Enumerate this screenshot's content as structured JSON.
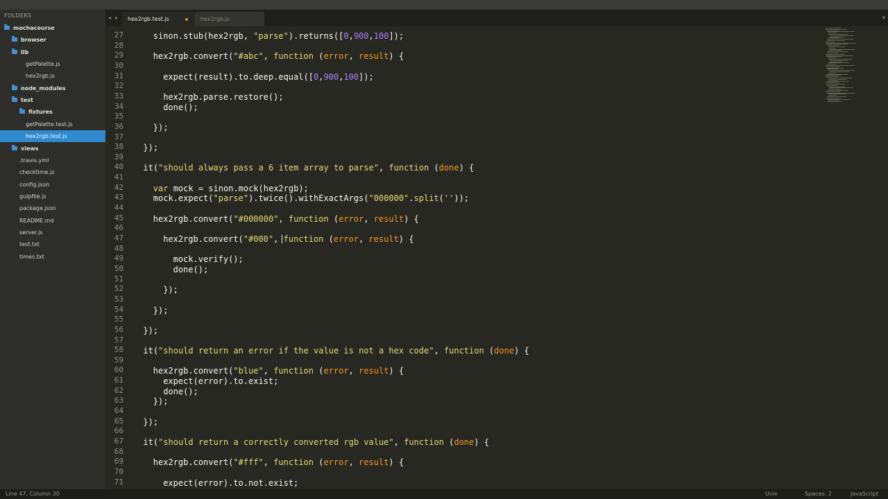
{
  "sidebar": {
    "heading": "FOLDERS",
    "items": [
      {
        "label": "mochacourse",
        "type": "folder",
        "depth": 0
      },
      {
        "label": "browser",
        "type": "folder",
        "depth": 1
      },
      {
        "label": "lib",
        "type": "folder",
        "depth": 1
      },
      {
        "label": "getPalette.js",
        "type": "file",
        "depth": 2
      },
      {
        "label": "hex2rgb.js",
        "type": "file",
        "depth": 2
      },
      {
        "label": "node_modules",
        "type": "folder",
        "depth": 1
      },
      {
        "label": "test",
        "type": "folder",
        "depth": 1
      },
      {
        "label": "fixtures",
        "type": "folder",
        "depth": 2
      },
      {
        "label": "getPalette.test.js",
        "type": "file",
        "depth": 2
      },
      {
        "label": "hex2rgb.test.js",
        "type": "file",
        "depth": 2,
        "selected": true
      },
      {
        "label": "views",
        "type": "folder",
        "depth": 1
      },
      {
        "label": ".travis.yml",
        "type": "file",
        "depth": 1
      },
      {
        "label": "checktime.js",
        "type": "file",
        "depth": 1
      },
      {
        "label": "config.json",
        "type": "file",
        "depth": 1
      },
      {
        "label": "gulpfile.js",
        "type": "file",
        "depth": 1
      },
      {
        "label": "package.json",
        "type": "file",
        "depth": 1
      },
      {
        "label": "README.md",
        "type": "file",
        "depth": 1
      },
      {
        "label": "server.js",
        "type": "file",
        "depth": 1
      },
      {
        "label": "test.txt",
        "type": "file",
        "depth": 1
      },
      {
        "label": "times.txt",
        "type": "file",
        "depth": 1
      }
    ]
  },
  "tabs": {
    "back_icon": "◂",
    "forward_icon": "▸",
    "active": "hex2rgb.test.js",
    "inactive": "hex2rgb.js",
    "scroll_icon": "▾"
  },
  "editor": {
    "lines": [
      {
        "n": "27",
        "indent": 2,
        "tokens": [
          [
            "k",
            "sinon.stub(hex2rgb, "
          ],
          [
            "s",
            "\"parse\""
          ],
          [
            "k",
            ").returns(["
          ],
          [
            "n",
            "0"
          ],
          [
            "k",
            ","
          ],
          [
            "n",
            "900"
          ],
          [
            "k",
            ","
          ],
          [
            "n",
            "100"
          ],
          [
            "k",
            "]);"
          ]
        ]
      },
      {
        "n": "28",
        "indent": 0,
        "tokens": []
      },
      {
        "n": "29",
        "indent": 2,
        "tokens": [
          [
            "k",
            "hex2rgb.convert("
          ],
          [
            "s",
            "\"#abc\""
          ],
          [
            "k",
            ", "
          ],
          [
            "kw",
            "function"
          ],
          [
            "k",
            " ("
          ],
          [
            "p",
            "error"
          ],
          [
            "k",
            ", "
          ],
          [
            "p",
            "result"
          ],
          [
            "k",
            ") {"
          ]
        ]
      },
      {
        "n": "30",
        "indent": 0,
        "tokens": []
      },
      {
        "n": "31",
        "indent": 3,
        "tokens": [
          [
            "k",
            "expect(result).to.deep.equal(["
          ],
          [
            "n",
            "0"
          ],
          [
            "k",
            ","
          ],
          [
            "n",
            "900"
          ],
          [
            "k",
            ","
          ],
          [
            "n",
            "100"
          ],
          [
            "k",
            "]);"
          ]
        ]
      },
      {
        "n": "32",
        "indent": 0,
        "tokens": []
      },
      {
        "n": "33",
        "indent": 3,
        "tokens": [
          [
            "k",
            "hex2rgb.parse.restore();"
          ]
        ]
      },
      {
        "n": "34",
        "indent": 3,
        "tokens": [
          [
            "k",
            "done();"
          ]
        ]
      },
      {
        "n": "35",
        "indent": 0,
        "tokens": []
      },
      {
        "n": "36",
        "indent": 2,
        "tokens": [
          [
            "k",
            "});"
          ]
        ]
      },
      {
        "n": "37",
        "indent": 0,
        "tokens": []
      },
      {
        "n": "38",
        "indent": 1,
        "tokens": [
          [
            "k",
            "});"
          ]
        ]
      },
      {
        "n": "39",
        "indent": 0,
        "tokens": []
      },
      {
        "n": "40",
        "indent": 1,
        "tokens": [
          [
            "k",
            "it("
          ],
          [
            "s",
            "\"should always pass a 6 item array to parse\""
          ],
          [
            "k",
            ", "
          ],
          [
            "kw",
            "function"
          ],
          [
            "k",
            " ("
          ],
          [
            "p",
            "done"
          ],
          [
            "k",
            ") {"
          ]
        ]
      },
      {
        "n": "41",
        "indent": 0,
        "tokens": []
      },
      {
        "n": "42",
        "indent": 2,
        "tokens": [
          [
            "kw",
            "var"
          ],
          [
            "k",
            " mock = sinon.mock(hex2rgb);"
          ]
        ]
      },
      {
        "n": "43",
        "indent": 2,
        "tokens": [
          [
            "k",
            "mock.expect("
          ],
          [
            "s",
            "\"parse\""
          ],
          [
            "k",
            ").twice().withExactArgs("
          ],
          [
            "s",
            "\"000000\""
          ],
          [
            "k",
            "."
          ],
          [
            "y",
            "split"
          ],
          [
            "k",
            "("
          ],
          [
            "s",
            "''"
          ],
          [
            "k",
            "));"
          ]
        ]
      },
      {
        "n": "44",
        "indent": 0,
        "tokens": []
      },
      {
        "n": "45",
        "indent": 2,
        "tokens": [
          [
            "k",
            "hex2rgb.convert("
          ],
          [
            "s",
            "\"#000000\""
          ],
          [
            "k",
            ", "
          ],
          [
            "kw",
            "function"
          ],
          [
            "k",
            " ("
          ],
          [
            "p",
            "error"
          ],
          [
            "k",
            ", "
          ],
          [
            "p",
            "result"
          ],
          [
            "k",
            ") {"
          ]
        ]
      },
      {
        "n": "46",
        "indent": 0,
        "tokens": []
      },
      {
        "n": "47",
        "indent": 3,
        "tokens": [
          [
            "k",
            "hex2rgb.convert("
          ],
          [
            "s",
            "\"#000\""
          ],
          [
            "k",
            ", "
          ],
          [
            "kw",
            "function"
          ],
          [
            "k",
            " ("
          ],
          [
            "p",
            "error"
          ],
          [
            "k",
            ", "
          ],
          [
            "p",
            "result"
          ],
          [
            "k",
            ") {"
          ]
        ]
      },
      {
        "n": "48",
        "indent": 0,
        "tokens": []
      },
      {
        "n": "49",
        "indent": 4,
        "tokens": [
          [
            "k",
            "mock.verify();"
          ]
        ]
      },
      {
        "n": "50",
        "indent": 4,
        "tokens": [
          [
            "k",
            "done();"
          ]
        ]
      },
      {
        "n": "51",
        "indent": 0,
        "tokens": []
      },
      {
        "n": "52",
        "indent": 3,
        "tokens": [
          [
            "k",
            "});"
          ]
        ]
      },
      {
        "n": "53",
        "indent": 0,
        "tokens": []
      },
      {
        "n": "54",
        "indent": 2,
        "tokens": [
          [
            "k",
            "});"
          ]
        ]
      },
      {
        "n": "55",
        "indent": 0,
        "tokens": []
      },
      {
        "n": "56",
        "indent": 1,
        "tokens": [
          [
            "k",
            "});"
          ]
        ]
      },
      {
        "n": "57",
        "indent": 0,
        "tokens": []
      },
      {
        "n": "58",
        "indent": 1,
        "tokens": [
          [
            "k",
            "it("
          ],
          [
            "s",
            "\"should return an error if the value is not a hex code\""
          ],
          [
            "k",
            ", "
          ],
          [
            "kw",
            "function"
          ],
          [
            "k",
            " ("
          ],
          [
            "p",
            "done"
          ],
          [
            "k",
            ") {"
          ]
        ]
      },
      {
        "n": "59",
        "indent": 0,
        "tokens": []
      },
      {
        "n": "60",
        "indent": 2,
        "tokens": [
          [
            "k",
            "hex2rgb.convert("
          ],
          [
            "s",
            "\"blue\""
          ],
          [
            "k",
            ", "
          ],
          [
            "kw",
            "function"
          ],
          [
            "k",
            " ("
          ],
          [
            "p",
            "error"
          ],
          [
            "k",
            ", "
          ],
          [
            "p",
            "result"
          ],
          [
            "k",
            ") {"
          ]
        ]
      },
      {
        "n": "61",
        "indent": 3,
        "tokens": [
          [
            "k",
            "expect(error).to.exist;"
          ]
        ]
      },
      {
        "n": "62",
        "indent": 3,
        "tokens": [
          [
            "k",
            "done();"
          ]
        ]
      },
      {
        "n": "63",
        "indent": 2,
        "tokens": [
          [
            "k",
            "});"
          ]
        ]
      },
      {
        "n": "64",
        "indent": 0,
        "tokens": []
      },
      {
        "n": "65",
        "indent": 1,
        "tokens": [
          [
            "k",
            "});"
          ]
        ]
      },
      {
        "n": "66",
        "indent": 0,
        "tokens": []
      },
      {
        "n": "67",
        "indent": 1,
        "tokens": [
          [
            "k",
            "it("
          ],
          [
            "s",
            "\"should return a correctly converted rgb value\""
          ],
          [
            "k",
            ", "
          ],
          [
            "kw",
            "function"
          ],
          [
            "k",
            " ("
          ],
          [
            "p",
            "done"
          ],
          [
            "k",
            ") {"
          ]
        ]
      },
      {
        "n": "68",
        "indent": 0,
        "tokens": []
      },
      {
        "n": "69",
        "indent": 2,
        "tokens": [
          [
            "k",
            "hex2rgb.convert("
          ],
          [
            "s",
            "\"#fff\""
          ],
          [
            "k",
            ", "
          ],
          [
            "kw",
            "function"
          ],
          [
            "k",
            " ("
          ],
          [
            "p",
            "error"
          ],
          [
            "k",
            ", "
          ],
          [
            "p",
            "result"
          ],
          [
            "k",
            ") {"
          ]
        ]
      },
      {
        "n": "70",
        "indent": 0,
        "tokens": []
      },
      {
        "n": "71",
        "indent": 3,
        "tokens": [
          [
            "k",
            "expect(error).to.not.exist;"
          ]
        ]
      }
    ],
    "cursor_line": "47",
    "cursor_column": 30,
    "colors": {
      "background": "#272822",
      "string": "#e6db74",
      "number": "#ae81ff",
      "param": "#fd971f",
      "text": "#f8f8f2",
      "selection": "#2f8ad0"
    }
  },
  "status": {
    "position": "Line 47, Column 30",
    "line_endings": "Unix",
    "indentation": "Spaces: 2",
    "syntax": "JavaScript"
  }
}
